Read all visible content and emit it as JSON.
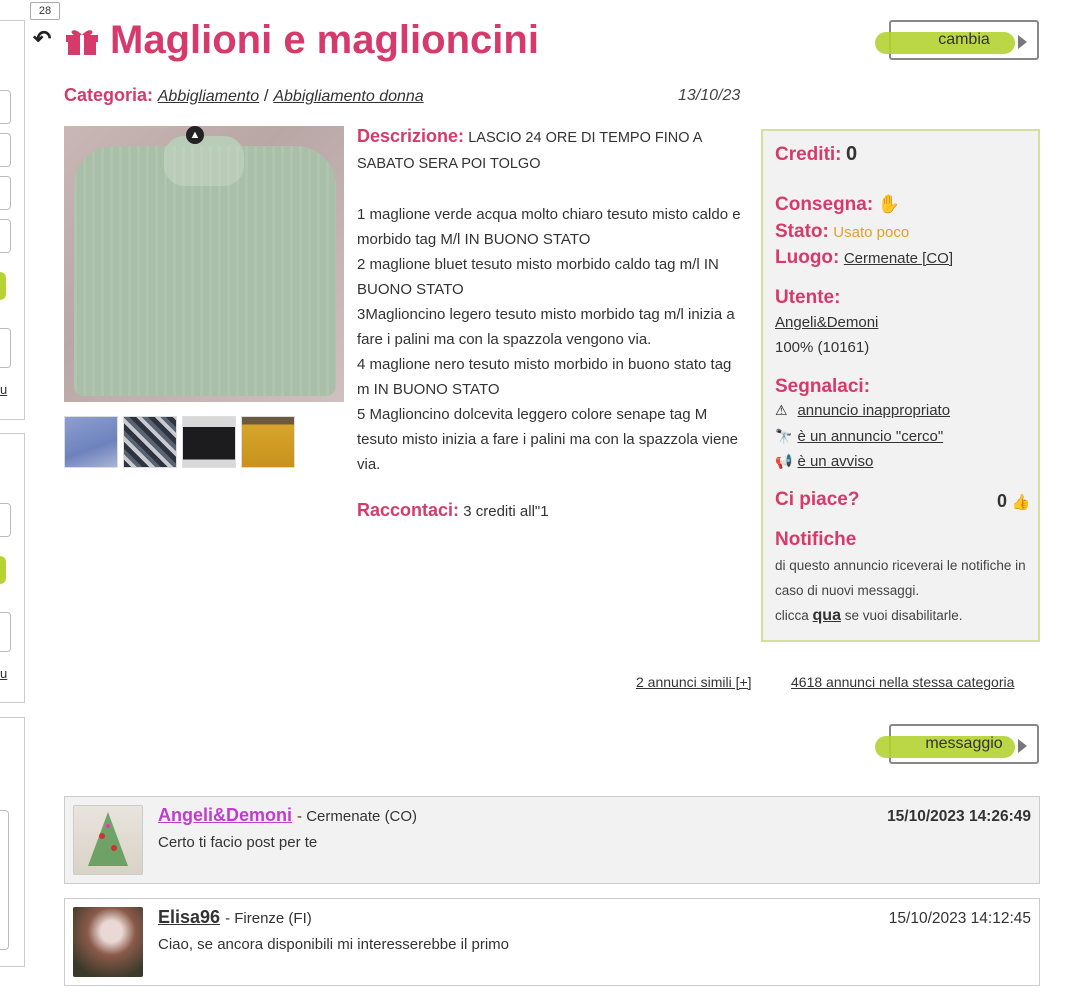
{
  "badge": "28",
  "title": "Maglioni e maglioncini",
  "buttons": {
    "cambia": "cambia",
    "messaggio": "messaggio"
  },
  "category": {
    "label": "Categoria:",
    "path1": "Abbigliamento",
    "sep": "/",
    "path2": "Abbigliamento donna",
    "date": "13/10/23"
  },
  "description": {
    "label": "Descrizione:",
    "intro": "LASCIO 24 ORE DI TEMPO FINO A SABATO SERA POI TOLGO",
    "items": [
      "1 maglione verde acqua molto chiaro tesuto misto caldo e morbido tag M/l IN BUONO STATO",
      "2 maglione bluet tesuto misto morbido caldo tag m/l IN BUONO STATO",
      "3Maglioncino legero tesuto misto morbido tag m/l inizia a fare i palini ma con la spazzola vengono via.",
      "4 maglione nero tesuto misto morbido in buono stato tag m IN BUONO STATO",
      "5 Maglioncino dolcevita leggero colore senape tag M tesuto misto inizia a fare i palini ma con la spazzola viene via."
    ]
  },
  "racconta": {
    "label": "Raccontaci:",
    "text": "3 crediti all\"1"
  },
  "info": {
    "crediti_label": "Crediti:",
    "crediti_value": "0",
    "consegna_label": "Consegna:",
    "consegna_icon": "hand-icon",
    "stato_label": "Stato:",
    "stato_value": "Usato poco",
    "luogo_label": "Luogo:",
    "luogo_value": "Cermenate [CO]",
    "utente_label": "Utente:",
    "utente_name": "Angeli&Demoni",
    "utente_rating": "100% (10161)",
    "segnalaci_label": "Segnalaci:",
    "report1": "annuncio inappropriato",
    "report2": "è un annuncio \"cerco\"",
    "report3": "è un avviso",
    "ci_piace_label": "Ci piace?",
    "likes": "0",
    "notifiche_label": "Notifiche",
    "notifiche_text1": "di questo annuncio riceverai le notifiche in caso di nuovi messaggi.",
    "notifiche_pre": "clicca",
    "notifiche_link": "qua",
    "notifiche_post": "se vuoi disabilitarle."
  },
  "links": {
    "simili": "2 annunci simili [+]",
    "categoria": "4618  annunci nella stessa categoria"
  },
  "comments": [
    {
      "user": "Angeli&Demoni",
      "location": "- Cermenate (CO)",
      "date": "15/10/2023 14:26:49",
      "text": "Certo ti facio post per te",
      "user_color": "#c03ccf",
      "date_bold": true
    },
    {
      "user": "Elisa96",
      "location": "- Firenze (FI)",
      "date": "15/10/2023 14:12:45",
      "text": "Ciao, se ancora disponibili mi interesserebbe il primo",
      "user_color": "#333333",
      "date_bold": false
    }
  ],
  "leftrail": {
    "link1": "u",
    "link2": "u"
  },
  "colors": {
    "accent": "#d63a6a",
    "green": "#b5d332",
    "orange": "#e0a12c"
  }
}
